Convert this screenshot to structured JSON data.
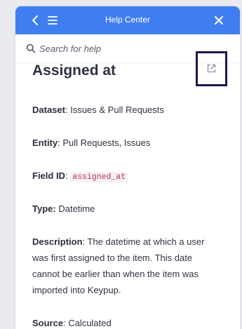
{
  "header": {
    "title": "Help Center",
    "back_icon": "chevron-left-icon",
    "menu_icon": "hamburger-menu-icon",
    "close_icon": "close-icon",
    "color": "#3f7ef0"
  },
  "search": {
    "placeholder": "Search for help",
    "icon": "search-icon"
  },
  "article": {
    "title": "Assigned at",
    "external_link_icon": "external-link-icon",
    "fields": [
      {
        "label": "Dataset",
        "sep": ": ",
        "value": "Issues & Pull Requests"
      },
      {
        "label": "Entity",
        "sep": ": ",
        "value": "Pull Requests, Issues"
      },
      {
        "label": "Field ID",
        "sep": ": ",
        "code": "assigned_at"
      },
      {
        "label": "Type:",
        "sep": " ",
        "value": "Datetime"
      },
      {
        "label": "Description",
        "sep": ": ",
        "value": "The datetime at which a user was first assigned to the item. This date cannot be earlier than when the item was imported into Keypup."
      },
      {
        "label": "Source",
        "sep": ": ",
        "value": "Calculated"
      }
    ]
  }
}
